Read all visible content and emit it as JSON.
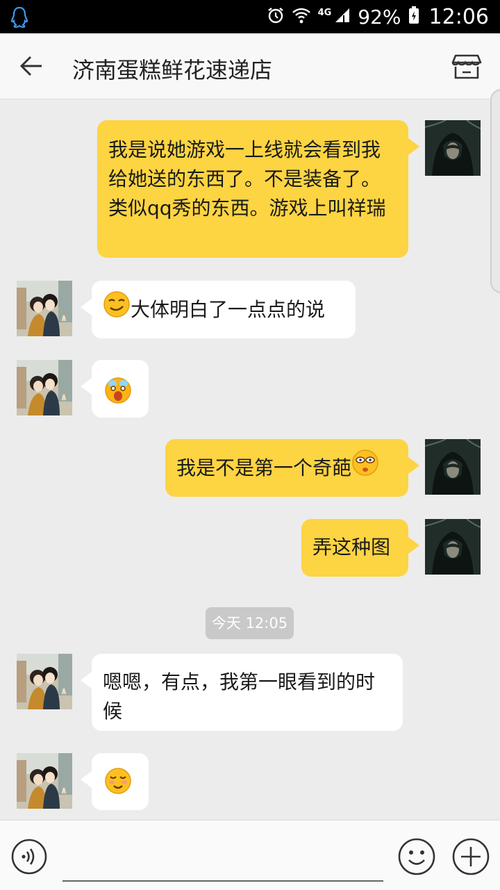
{
  "status_bar": {
    "network": "4G",
    "battery": "92%",
    "time": "12:06"
  },
  "header": {
    "title": "济南蛋糕鲜花速递店"
  },
  "messages": [
    {
      "sender": "me",
      "text": "我是说她游戏一上线就会看到我给她送的东西了。不是装备了。类似qq秀的东西。游戏上叫祥瑞"
    },
    {
      "sender": "other",
      "text": "大体明白了一点点的说",
      "emoji_before": "smirk-emoji"
    },
    {
      "sender": "other",
      "text": "",
      "emoji_before": "crying-emoji"
    },
    {
      "sender": "me",
      "text": "我是不是第一个奇葩",
      "emoji_after": "awkward-emoji"
    },
    {
      "sender": "me",
      "text": "弄这种图"
    },
    {
      "sender": "other",
      "text": "嗯嗯，有点，我第一眼看到的时候"
    },
    {
      "sender": "other",
      "text": "",
      "emoji_before": "shy-laugh-emoji"
    }
  ],
  "timestamp": "今天 12:05",
  "colors": {
    "my_bubble": "#fdd442",
    "other_bubble": "#ffffff",
    "background": "#ececec"
  }
}
